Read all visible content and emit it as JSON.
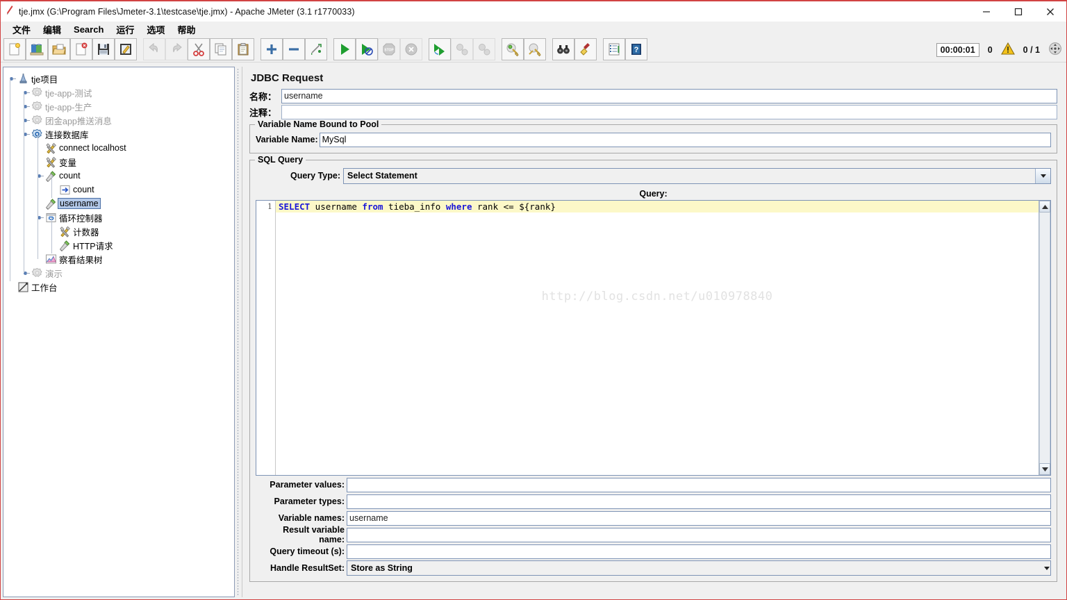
{
  "window": {
    "title": "tje.jmx (G:\\Program Files\\Jmeter-3.1\\testcase\\tje.jmx) - Apache JMeter (3.1 r1770033)",
    "app_icon": "jmeter-feather-icon",
    "minimize": "–",
    "maximize": "□",
    "close": "✕"
  },
  "menu": {
    "items": [
      {
        "label": "文件",
        "name": "menu-file"
      },
      {
        "label": "编辑",
        "name": "menu-edit"
      },
      {
        "label": "Search",
        "name": "menu-search"
      },
      {
        "label": "运行",
        "name": "menu-run"
      },
      {
        "label": "选项",
        "name": "menu-options"
      },
      {
        "label": "帮助",
        "name": "menu-help"
      }
    ]
  },
  "toolbar": {
    "buttons": [
      {
        "icon": "new-document-icon",
        "enabled": true
      },
      {
        "icon": "templates-icon",
        "enabled": true
      },
      {
        "icon": "open-folder-icon",
        "enabled": true
      },
      {
        "icon": "close-document-icon",
        "enabled": true
      },
      {
        "icon": "save-icon",
        "enabled": true
      },
      {
        "icon": "save-as-icon",
        "enabled": true
      },
      {
        "icon": "undo-icon",
        "enabled": false
      },
      {
        "icon": "redo-icon",
        "enabled": false
      },
      {
        "icon": "cut-icon",
        "enabled": true
      },
      {
        "icon": "copy-icon",
        "enabled": true
      },
      {
        "icon": "paste-icon",
        "enabled": true
      },
      {
        "icon": "expand-all-icon",
        "enabled": true
      },
      {
        "icon": "collapse-all-icon",
        "enabled": true
      },
      {
        "icon": "toggle-icon",
        "enabled": true
      },
      {
        "icon": "start-icon",
        "enabled": true
      },
      {
        "icon": "start-no-pauses-icon",
        "enabled": true
      },
      {
        "icon": "stop-icon",
        "enabled": false
      },
      {
        "icon": "shutdown-icon",
        "enabled": false
      },
      {
        "icon": "remote-start-all-icon",
        "enabled": true
      },
      {
        "icon": "remote-stop-all-icon",
        "enabled": false
      },
      {
        "icon": "remote-shutdown-all-icon",
        "enabled": false
      },
      {
        "icon": "clear-icon",
        "enabled": true
      },
      {
        "icon": "clear-all-icon",
        "enabled": true
      },
      {
        "icon": "search-binoculars-icon",
        "enabled": true
      },
      {
        "icon": "reset-search-broom-icon",
        "enabled": true
      },
      {
        "icon": "function-helper-icon",
        "enabled": true
      },
      {
        "icon": "help-icon",
        "enabled": true
      }
    ],
    "status": {
      "timer": "00:00:01",
      "warning_count": "0",
      "warning_icon": "warning-triangle-icon",
      "threads": "0 / 1",
      "remote_icon": "expand-indicator-icon"
    }
  },
  "tree": {
    "nodes": [
      {
        "label": "tje项目",
        "icon": "test-plan-icon",
        "depth": 0,
        "handle": true,
        "dim": false,
        "selected": false
      },
      {
        "label": "tje-app-测试",
        "icon": "thread-group-disabled-icon",
        "depth": 1,
        "handle": true,
        "dim": true,
        "selected": false
      },
      {
        "label": "tje-app-生产",
        "icon": "thread-group-disabled-icon",
        "depth": 1,
        "handle": true,
        "dim": true,
        "selected": false
      },
      {
        "label": "团金app推送消息",
        "icon": "thread-group-disabled-icon",
        "depth": 1,
        "handle": true,
        "dim": true,
        "selected": false
      },
      {
        "label": "连接数据库",
        "icon": "thread-group-icon",
        "depth": 1,
        "handle": true,
        "dim": false,
        "selected": false
      },
      {
        "label": "connect localhost",
        "icon": "config-element-icon",
        "depth": 2,
        "handle": false,
        "dim": false,
        "selected": false
      },
      {
        "label": "变量",
        "icon": "config-element-icon",
        "depth": 2,
        "handle": false,
        "dim": false,
        "selected": false
      },
      {
        "label": "count",
        "icon": "jdbc-request-icon",
        "depth": 2,
        "handle": true,
        "dim": false,
        "selected": false
      },
      {
        "label": "count",
        "icon": "post-processor-icon",
        "depth": 3,
        "handle": false,
        "dim": false,
        "selected": false
      },
      {
        "label": "username",
        "icon": "jdbc-request-icon",
        "depth": 2,
        "handle": false,
        "dim": false,
        "selected": true
      },
      {
        "label": "循环控制器",
        "icon": "loop-controller-icon",
        "depth": 2,
        "handle": true,
        "dim": false,
        "selected": false
      },
      {
        "label": "计数器",
        "icon": "config-element-icon",
        "depth": 3,
        "handle": false,
        "dim": false,
        "selected": false
      },
      {
        "label": "HTTP请求",
        "icon": "jdbc-request-icon",
        "depth": 3,
        "handle": false,
        "dim": false,
        "selected": false
      },
      {
        "label": "察看结果树",
        "icon": "view-results-tree-icon",
        "depth": 2,
        "handle": false,
        "dim": false,
        "selected": false
      },
      {
        "label": "演示",
        "icon": "thread-group-disabled-icon",
        "depth": 1,
        "handle": true,
        "dim": true,
        "selected": false
      },
      {
        "label": "工作台",
        "icon": "workbench-icon",
        "depth": 0,
        "handle": false,
        "dim": false,
        "selected": false
      }
    ]
  },
  "panel": {
    "title": "JDBC Request",
    "name_label": "名称：",
    "name_value": "username",
    "comment_label": "注释：",
    "comment_value": "",
    "pool_group_title": "Variable Name Bound to Pool",
    "variable_name_label": "Variable Name:",
    "variable_name_value": "MySql",
    "sql_group_title": "SQL Query",
    "query_type_label": "Query Type:",
    "query_type_value": "Select Statement",
    "query_caption": "Query:",
    "editor": {
      "line_number": "1",
      "sql_tokens": [
        {
          "text": "SELECT",
          "kw": true
        },
        {
          "text": " username ",
          "kw": false
        },
        {
          "text": "from",
          "kw": true
        },
        {
          "text": " tieba_info ",
          "kw": false
        },
        {
          "text": "where",
          "kw": true
        },
        {
          "text": " rank <= ${rank}",
          "kw": false
        }
      ],
      "sql_plain": "SELECT username from tieba_info where rank <= ${rank}"
    },
    "watermark": "http://blog.csdn.net/u010978840",
    "fields": [
      {
        "label": "Parameter values:",
        "value": "",
        "type": "text",
        "name": "parameter-values-input"
      },
      {
        "label": "Parameter types:",
        "value": "",
        "type": "text",
        "name": "parameter-types-input"
      },
      {
        "label": "Variable names:",
        "value": "username",
        "type": "text",
        "name": "variable-names-input"
      },
      {
        "label": "Result variable name:",
        "value": "",
        "type": "text",
        "name": "result-variable-name-input"
      },
      {
        "label": "Query timeout (s):",
        "value": "",
        "type": "text",
        "name": "query-timeout-input"
      },
      {
        "label": "Handle ResultSet:",
        "value": "Store as String",
        "type": "combo",
        "name": "handle-resultset-combo"
      }
    ]
  },
  "colors": {
    "accent": "#d14343",
    "selection": "#b3c8e8",
    "keyword": "#1a16d8",
    "code_line": "#fcf8c8"
  }
}
